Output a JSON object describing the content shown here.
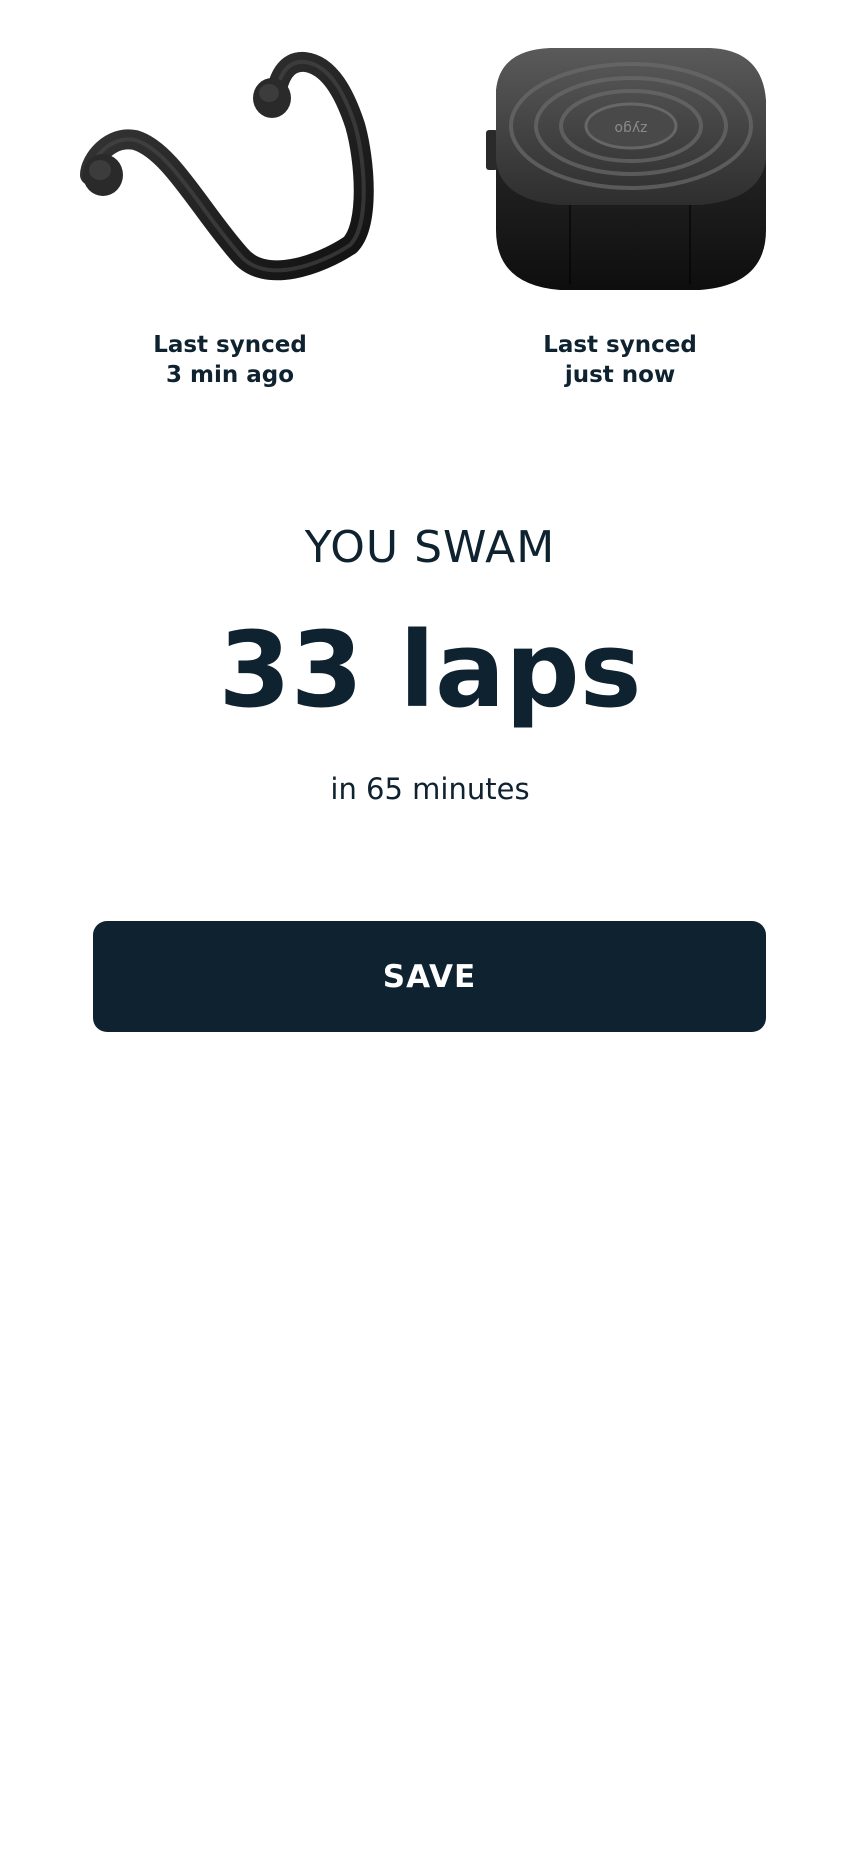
{
  "devices": [
    {
      "icon": "headphones-icon",
      "sync_line1": "Last synced",
      "sync_line2": "3 min ago"
    },
    {
      "icon": "charging-case-icon",
      "sync_line1": "Last synced",
      "sync_line2": "just now",
      "case_logo": "zygo"
    }
  ],
  "summary": {
    "heading": "YOU SWAM",
    "value": "33 laps",
    "subtitle": "in 65 minutes"
  },
  "actions": {
    "save_label": "SAVE"
  },
  "colors": {
    "primary": "#0f2230",
    "background": "#ffffff",
    "device_dark": "#1c1c1c"
  }
}
